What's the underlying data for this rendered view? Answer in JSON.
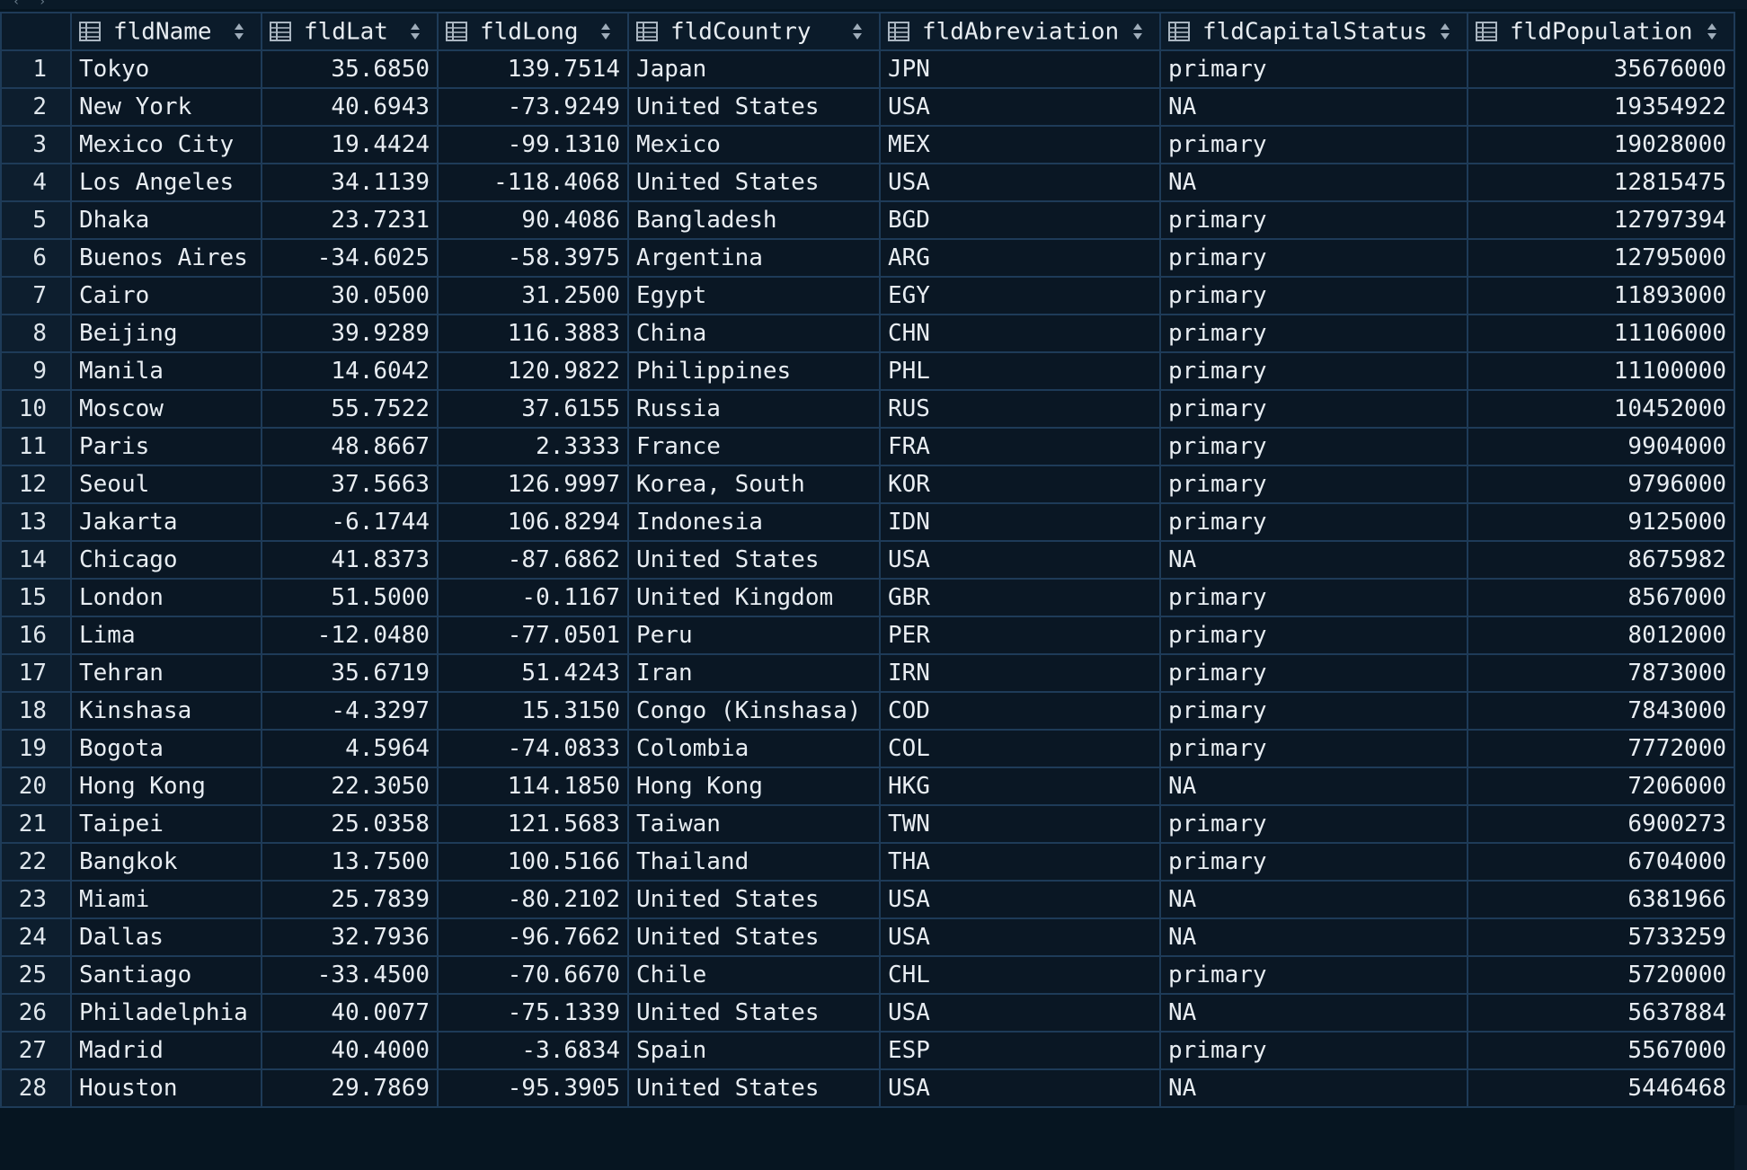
{
  "columns": [
    {
      "label": "fldName",
      "align": "txt"
    },
    {
      "label": "fldLat",
      "align": "num"
    },
    {
      "label": "fldLong",
      "align": "num"
    },
    {
      "label": "fldCountry",
      "align": "txt"
    },
    {
      "label": "fldAbreviation",
      "align": "txt"
    },
    {
      "label": "fldCapitalStatus",
      "align": "txt"
    },
    {
      "label": "fldPopulation",
      "align": "num"
    }
  ],
  "rows": [
    {
      "n": "1",
      "cells": [
        "Tokyo",
        "35.6850",
        "139.7514",
        "Japan",
        "JPN",
        "primary",
        "35676000"
      ]
    },
    {
      "n": "2",
      "cells": [
        "New York",
        "40.6943",
        "-73.9249",
        "United States",
        "USA",
        "NA",
        "19354922"
      ]
    },
    {
      "n": "3",
      "cells": [
        "Mexico City",
        "19.4424",
        "-99.1310",
        "Mexico",
        "MEX",
        "primary",
        "19028000"
      ]
    },
    {
      "n": "4",
      "cells": [
        "Los Angeles",
        "34.1139",
        "-118.4068",
        "United States",
        "USA",
        "NA",
        "12815475"
      ]
    },
    {
      "n": "5",
      "cells": [
        "Dhaka",
        "23.7231",
        "90.4086",
        "Bangladesh",
        "BGD",
        "primary",
        "12797394"
      ]
    },
    {
      "n": "6",
      "cells": [
        "Buenos Aires",
        "-34.6025",
        "-58.3975",
        "Argentina",
        "ARG",
        "primary",
        "12795000"
      ]
    },
    {
      "n": "7",
      "cells": [
        "Cairo",
        "30.0500",
        "31.2500",
        "Egypt",
        "EGY",
        "primary",
        "11893000"
      ]
    },
    {
      "n": "8",
      "cells": [
        "Beijing",
        "39.9289",
        "116.3883",
        "China",
        "CHN",
        "primary",
        "11106000"
      ]
    },
    {
      "n": "9",
      "cells": [
        "Manila",
        "14.6042",
        "120.9822",
        "Philippines",
        "PHL",
        "primary",
        "11100000"
      ]
    },
    {
      "n": "10",
      "cells": [
        "Moscow",
        "55.7522",
        "37.6155",
        "Russia",
        "RUS",
        "primary",
        "10452000"
      ]
    },
    {
      "n": "11",
      "cells": [
        "Paris",
        "48.8667",
        "2.3333",
        "France",
        "FRA",
        "primary",
        "9904000"
      ]
    },
    {
      "n": "12",
      "cells": [
        "Seoul",
        "37.5663",
        "126.9997",
        "Korea, South",
        "KOR",
        "primary",
        "9796000"
      ]
    },
    {
      "n": "13",
      "cells": [
        "Jakarta",
        "-6.1744",
        "106.8294",
        "Indonesia",
        "IDN",
        "primary",
        "9125000"
      ]
    },
    {
      "n": "14",
      "cells": [
        "Chicago",
        "41.8373",
        "-87.6862",
        "United States",
        "USA",
        "NA",
        "8675982"
      ]
    },
    {
      "n": "15",
      "cells": [
        "London",
        "51.5000",
        "-0.1167",
        "United Kingdom",
        "GBR",
        "primary",
        "8567000"
      ]
    },
    {
      "n": "16",
      "cells": [
        "Lima",
        "-12.0480",
        "-77.0501",
        "Peru",
        "PER",
        "primary",
        "8012000"
      ]
    },
    {
      "n": "17",
      "cells": [
        "Tehran",
        "35.6719",
        "51.4243",
        "Iran",
        "IRN",
        "primary",
        "7873000"
      ]
    },
    {
      "n": "18",
      "cells": [
        "Kinshasa",
        "-4.3297",
        "15.3150",
        "Congo (Kinshasa)",
        "COD",
        "primary",
        "7843000"
      ]
    },
    {
      "n": "19",
      "cells": [
        "Bogota",
        "4.5964",
        "-74.0833",
        "Colombia",
        "COL",
        "primary",
        "7772000"
      ]
    },
    {
      "n": "20",
      "cells": [
        "Hong Kong",
        "22.3050",
        "114.1850",
        "Hong Kong",
        "HKG",
        "NA",
        "7206000"
      ]
    },
    {
      "n": "21",
      "cells": [
        "Taipei",
        "25.0358",
        "121.5683",
        "Taiwan",
        "TWN",
        "primary",
        "6900273"
      ]
    },
    {
      "n": "22",
      "cells": [
        "Bangkok",
        "13.7500",
        "100.5166",
        "Thailand",
        "THA",
        "primary",
        "6704000"
      ]
    },
    {
      "n": "23",
      "cells": [
        "Miami",
        "25.7839",
        "-80.2102",
        "United States",
        "USA",
        "NA",
        "6381966"
      ]
    },
    {
      "n": "24",
      "cells": [
        "Dallas",
        "32.7936",
        "-96.7662",
        "United States",
        "USA",
        "NA",
        "5733259"
      ]
    },
    {
      "n": "25",
      "cells": [
        "Santiago",
        "-33.4500",
        "-70.6670",
        "Chile",
        "CHL",
        "primary",
        "5720000"
      ]
    },
    {
      "n": "26",
      "cells": [
        "Philadelphia",
        "40.0077",
        "-75.1339",
        "United States",
        "USA",
        "NA",
        "5637884"
      ]
    },
    {
      "n": "27",
      "cells": [
        "Madrid",
        "40.4000",
        "-3.6834",
        "Spain",
        "ESP",
        "primary",
        "5567000"
      ]
    },
    {
      "n": "28",
      "cells": [
        "Houston",
        "29.7869",
        "-95.3905",
        "United States",
        "USA",
        "NA",
        "5446468"
      ]
    }
  ],
  "icons": {
    "column_type": "table-column-icon",
    "sort": "sort-arrows-icon"
  },
  "colors": {
    "background": "#0a1724",
    "header_background": "#0b1b2a",
    "grid_line": "#1e3b58",
    "text": "#e8edf2"
  }
}
